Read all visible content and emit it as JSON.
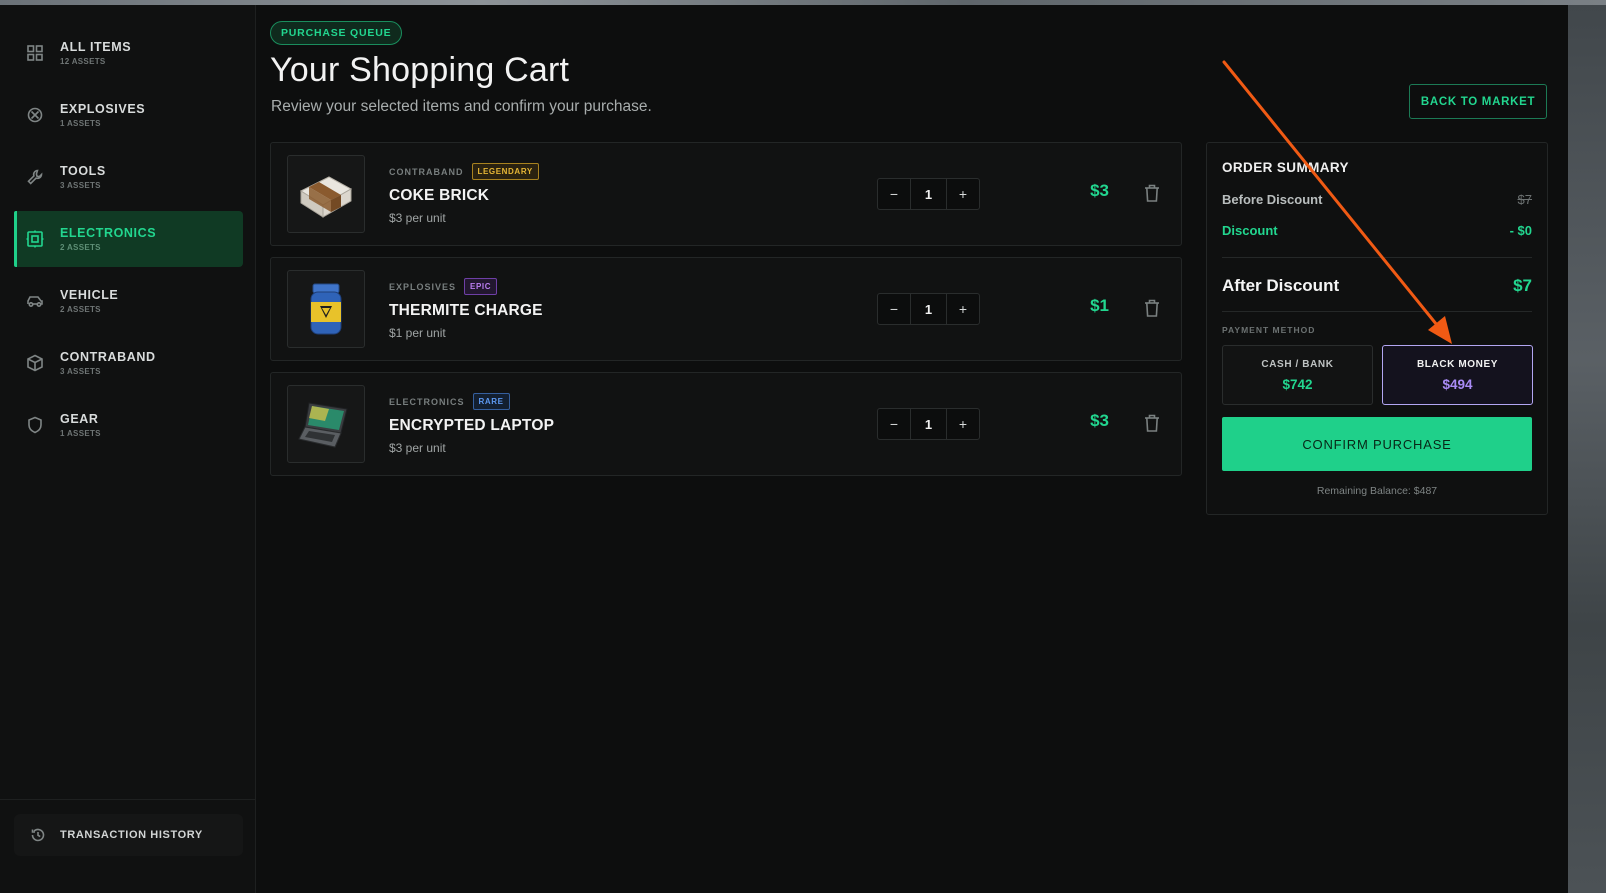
{
  "sidebar": {
    "categories": [
      {
        "label": "ALL ITEMS",
        "count": "12 ASSETS",
        "icon": "grid-icon"
      },
      {
        "label": "EXPLOSIVES",
        "count": "1 ASSETS",
        "icon": "bomb-icon"
      },
      {
        "label": "TOOLS",
        "count": "3 ASSETS",
        "icon": "wrench-icon"
      },
      {
        "label": "ELECTRONICS",
        "count": "2 ASSETS",
        "icon": "chip-icon",
        "active": true
      },
      {
        "label": "VEHICLE",
        "count": "2 ASSETS",
        "icon": "car-icon"
      },
      {
        "label": "CONTRABAND",
        "count": "3 ASSETS",
        "icon": "box-icon"
      },
      {
        "label": "GEAR",
        "count": "1 ASSETS",
        "icon": "shield-icon"
      }
    ],
    "history_label": "TRANSACTION HISTORY"
  },
  "header": {
    "badge": "PURCHASE QUEUE",
    "title": "Your Shopping Cart",
    "subtitle": "Review your selected items and confirm your purchase.",
    "back_label": "BACK TO MARKET"
  },
  "cart": {
    "items": [
      {
        "category": "CONTRABAND",
        "rarity": "LEGENDARY",
        "name": "COKE BRICK",
        "unit_price": "$3 per unit",
        "qty": "1",
        "price": "$3",
        "thumb": "brick-icon"
      },
      {
        "category": "EXPLOSIVES",
        "rarity": "EPIC",
        "name": "THERMITE CHARGE",
        "unit_price": "$1 per unit",
        "qty": "1",
        "price": "$1",
        "thumb": "jar-icon"
      },
      {
        "category": "ELECTRONICS",
        "rarity": "RARE",
        "name": "ENCRYPTED LAPTOP",
        "unit_price": "$3 per unit",
        "qty": "1",
        "price": "$3",
        "thumb": "laptop-icon"
      }
    ],
    "minus": "−",
    "plus": "+"
  },
  "summary": {
    "title": "ORDER SUMMARY",
    "before_label": "Before Discount",
    "before_value": "$7",
    "discount_label": "Discount",
    "discount_value": "- $0",
    "after_label": "After Discount",
    "after_value": "$7",
    "payment_label": "PAYMENT METHOD",
    "cash_label": "CASH / BANK",
    "cash_value": "$742",
    "black_label": "BLACK MONEY",
    "black_value": "$494",
    "selected_payment": "BLACK MONEY",
    "confirm_label": "CONFIRM PURCHASE",
    "remaining": "Remaining Balance: $487"
  },
  "colors": {
    "accent": "#1fd08a",
    "legendary": "#e6b636",
    "epic": "#b97cf0",
    "rare": "#5d98f0",
    "annotation_arrow": "#f05a14"
  }
}
